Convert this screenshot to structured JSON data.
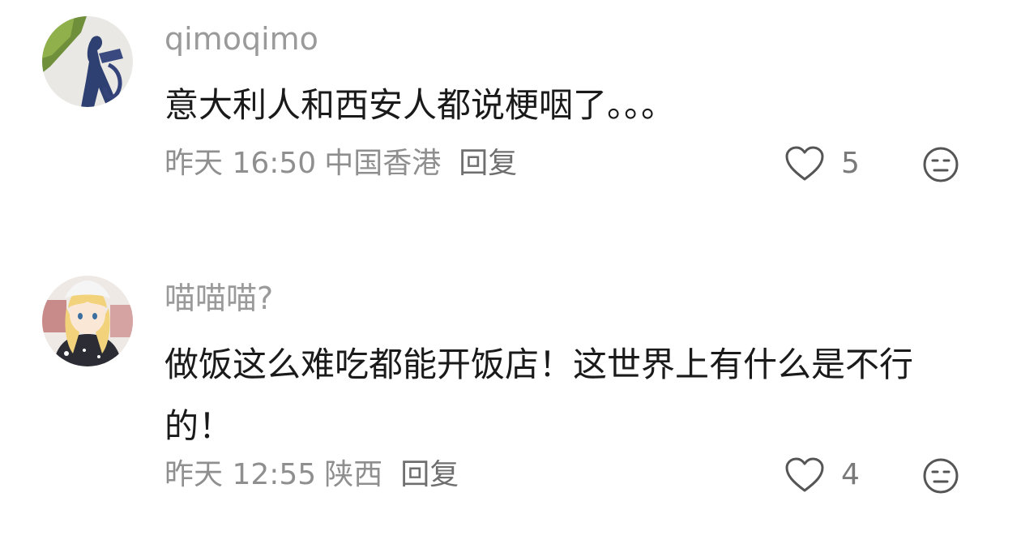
{
  "comments": [
    {
      "username": "qimoqimo",
      "content": "意大利人和西安人都说梗咽了。。。",
      "time": "昨天 16:50",
      "location": "中国香港",
      "reply_label": "回复",
      "likes": "5",
      "avatar_icon": "silhouette-avatar-icon"
    },
    {
      "username": "喵喵喵?",
      "content": "做饭这么难吃都能开饭店！这世界上有什么是不行的！",
      "time": "昨天 12:55",
      "location": "陕西",
      "reply_label": "回复",
      "likes": "4",
      "avatar_icon": "anime-girl-avatar-icon"
    }
  ],
  "colors": {
    "username": "#9a9a9a",
    "content": "#1a1a1a",
    "meta": "#8f8f8f",
    "icon_stroke": "#555555"
  }
}
